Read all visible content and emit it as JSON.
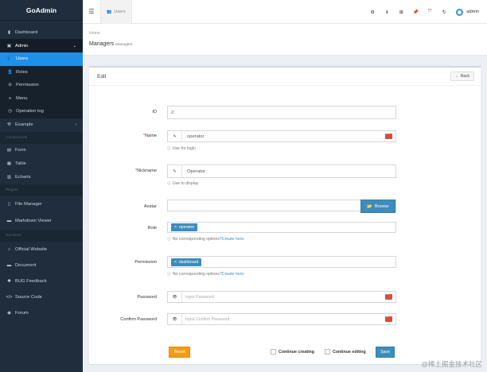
{
  "app": {
    "title": "GoAdmin"
  },
  "sidebar": {
    "items": [
      {
        "label": "Dashboard",
        "icon": "▮"
      },
      {
        "label": "Admin",
        "icon": "▣",
        "chevron": "⌄"
      },
      {
        "label": "Users",
        "icon": "👥"
      },
      {
        "label": "Roles",
        "icon": "👤"
      },
      {
        "label": "Permission",
        "icon": "⊘"
      },
      {
        "label": "Menu",
        "icon": "≡"
      },
      {
        "label": "Operation log",
        "icon": "◷"
      },
      {
        "label": "Example",
        "icon": "⚒",
        "chevron": "‹"
      }
    ],
    "header_components": "Components",
    "components": [
      {
        "label": "Form",
        "icon": "▤"
      },
      {
        "label": "Table",
        "icon": "▦"
      },
      {
        "label": "Echarts",
        "icon": "▥"
      }
    ],
    "header_plugins": "Plugins",
    "plugins": [
      {
        "label": "File Manager",
        "icon": "▯"
      },
      {
        "label": "Markdown Viewer",
        "icon": "▬"
      }
    ],
    "header_goadmin": "GoAdmin",
    "goadmin": [
      {
        "label": "Official Website",
        "icon": "⌂"
      },
      {
        "label": "Document",
        "icon": "▬"
      },
      {
        "label": "BUG Feedback",
        "icon": "✱"
      },
      {
        "label": "Source Code",
        "icon": "</>"
      },
      {
        "label": "Forum",
        "icon": "◉"
      }
    ]
  },
  "topbar": {
    "tab_label": "Users",
    "tab_icon": "👥",
    "icons": [
      "⚙",
      "ℹ",
      "⊞",
      "📌",
      "⤧",
      "↻"
    ],
    "user_name": "admin"
  },
  "breadcrumb": {
    "home": "Home"
  },
  "page": {
    "title": "Managers",
    "subtitle": "Managers"
  },
  "box": {
    "title": "Edit",
    "back_label": "Back",
    "back_icon": "←"
  },
  "form": {
    "id": {
      "label": "ID",
      "value": "2"
    },
    "name": {
      "required": "*",
      "label": "Name",
      "value": "operator",
      "help": "Use for login",
      "icon": "✎"
    },
    "nickname": {
      "required": "*",
      "label": "Nickname",
      "value": "Operator",
      "help": "Use to display",
      "icon": "✎"
    },
    "avatar": {
      "label": "Avatar",
      "browse": "Browse",
      "browse_icon": "📂"
    },
    "role": {
      "label": "Role",
      "tag": "operator",
      "help_text": "No corresponding options?",
      "help_link": "Create here."
    },
    "permission": {
      "label": "Permission",
      "tag": "dashboard",
      "help_text": "No corresponding options?",
      "help_link": "Create here."
    },
    "password": {
      "label": "Password",
      "placeholder": "Input Password",
      "icon": "👁"
    },
    "confirm_password": {
      "label": "Confirm Password",
      "placeholder": "Input Confirm Password",
      "icon": "👁"
    }
  },
  "footer": {
    "reset": "Reset",
    "continue_creating": "Continue creating",
    "continue_editing": "Continue editing",
    "save": "Save"
  },
  "watermark": "@稀土掘金技术社区",
  "colors": {
    "sidebar": "#1f2d3d",
    "active": "#1e90e8",
    "primary": "#3c8dbc",
    "warning": "#f39c12",
    "danger": "#dd4b39"
  }
}
